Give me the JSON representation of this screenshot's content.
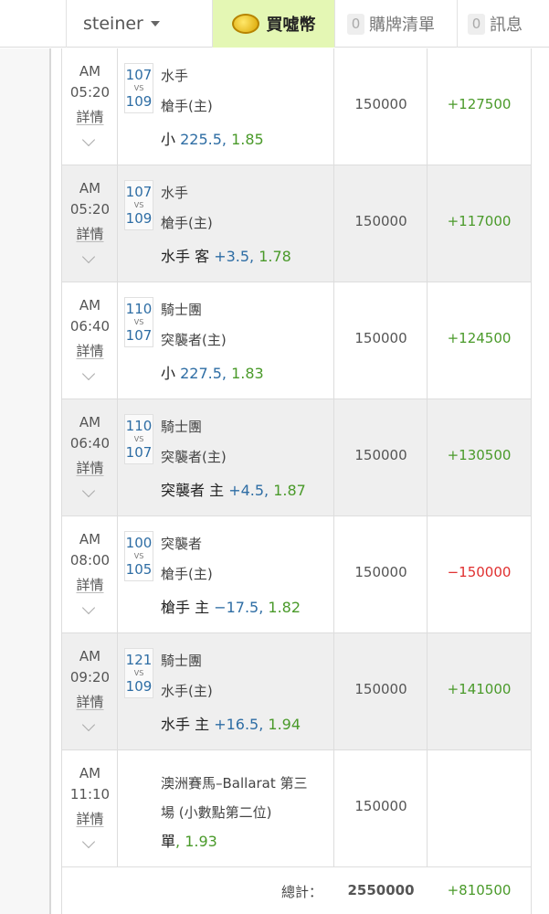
{
  "header": {
    "username": "steiner",
    "buy_coin": "買噓幣",
    "coin_logo": "噓幣",
    "cart_count": "0",
    "cart_label": "購牌清單",
    "msg_count": "0",
    "msg_label": "訊息"
  },
  "detail_label": "詳情",
  "vs_label": "VS",
  "rows": [
    {
      "ampm": "AM",
      "time": "05:20",
      "num_a": "107",
      "team_a": "水手",
      "num_b": "109",
      "team_b": "槍手(主)",
      "bet_pick": "小",
      "bet_line": "225.5,",
      "bet_odds": "1.85",
      "stake": "150000",
      "result": "+127500"
    },
    {
      "ampm": "AM",
      "time": "05:20",
      "num_a": "107",
      "team_a": "水手",
      "num_b": "109",
      "team_b": "槍手(主)",
      "bet_pick": "水手 客",
      "bet_line": "+3.5,",
      "bet_odds": "1.78",
      "stake": "150000",
      "result": "+117000"
    },
    {
      "ampm": "AM",
      "time": "06:40",
      "num_a": "110",
      "team_a": "騎士團",
      "num_b": "107",
      "team_b": "突襲者(主)",
      "bet_pick": "小",
      "bet_line": "227.5,",
      "bet_odds": "1.83",
      "stake": "150000",
      "result": "+124500"
    },
    {
      "ampm": "AM",
      "time": "06:40",
      "num_a": "110",
      "team_a": "騎士團",
      "num_b": "107",
      "team_b": "突襲者(主)",
      "bet_pick": "突襲者 主",
      "bet_line": "+4.5,",
      "bet_odds": "1.87",
      "stake": "150000",
      "result": "+130500"
    },
    {
      "ampm": "AM",
      "time": "08:00",
      "num_a": "100",
      "team_a": "突襲者",
      "num_b": "105",
      "team_b": "槍手(主)",
      "bet_pick": "槍手 主",
      "bet_line": "−17.5,",
      "bet_odds": "1.82",
      "stake": "150000",
      "result": "−150000"
    },
    {
      "ampm": "AM",
      "time": "09:20",
      "num_a": "121",
      "team_a": "騎士團",
      "num_b": "109",
      "team_b": "水手(主)",
      "bet_pick": "水手 主",
      "bet_line": "+16.5,",
      "bet_odds": "1.94",
      "stake": "150000",
      "result": "+141000"
    }
  ],
  "race_row": {
    "ampm": "AM",
    "time": "11:10",
    "line1": "澳洲賽馬–Ballarat 第三",
    "line2": "場 (小數點第二位)",
    "bet_pick": "單",
    "bet_odds": ", 1.93",
    "stake": "150000"
  },
  "totals": {
    "label": "總計：",
    "stake": "2550000",
    "result": "+810500"
  }
}
